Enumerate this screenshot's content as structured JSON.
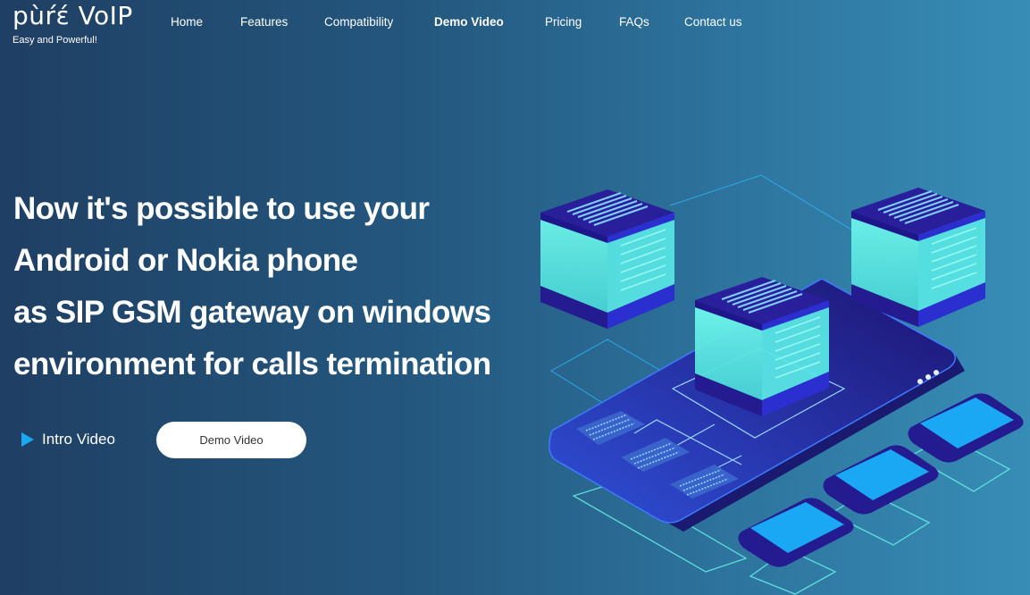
{
  "brand": {
    "name": "pùŕέ VoIP",
    "tagline": "Easy and Powerful!"
  },
  "nav": {
    "items": [
      {
        "label": "Home",
        "active": false
      },
      {
        "label": "Features",
        "active": false
      },
      {
        "label": "Compatibility",
        "active": false
      },
      {
        "label": "Demo Video",
        "active": true
      },
      {
        "label": "Pricing",
        "active": false
      },
      {
        "label": "FAQs",
        "active": false
      },
      {
        "label": "Contact us",
        "active": false
      }
    ]
  },
  "hero": {
    "headline_lines": [
      "Now it's possible to use your",
      "Android or Nokia phone",
      "as SIP GSM gateway on windows",
      "environment for calls termination"
    ],
    "intro_video_label": "Intro Video",
    "intro_video_icon": "play-icon",
    "demo_button_label": "Demo Video",
    "illustration": "isometric-servers-and-tablet-illustration"
  },
  "colors": {
    "bg_left": "#1f3f63",
    "bg_right": "#378db6",
    "play_icon": "#1aa8f0",
    "cyan": "#5ff0e6",
    "indigo": "#2a1f9a"
  }
}
